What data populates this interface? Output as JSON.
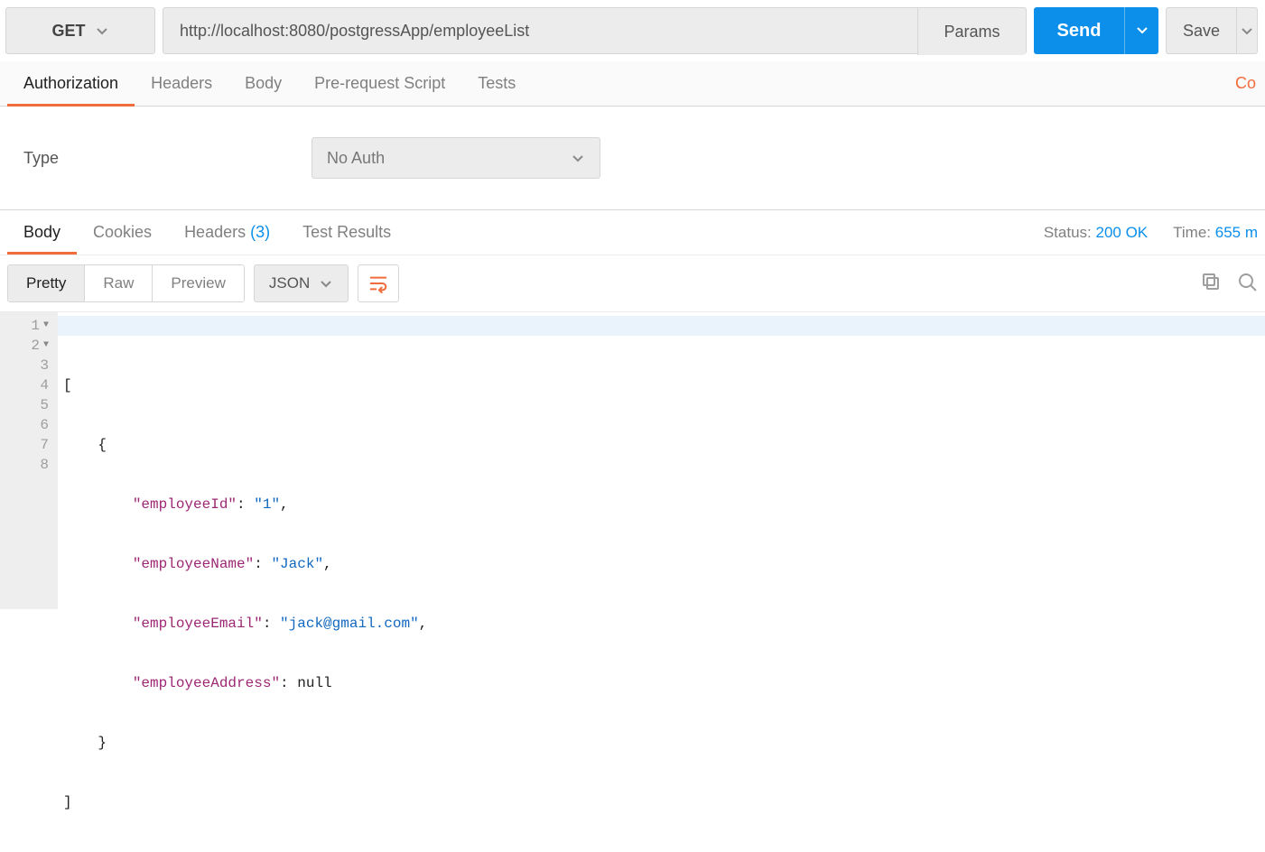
{
  "request": {
    "method": "GET",
    "url": "http://localhost:8080/postgressApp/employeeList",
    "params_btn": "Params",
    "send": "Send",
    "save": "Save"
  },
  "req_tabs": {
    "authorization": "Authorization",
    "headers": "Headers",
    "body": "Body",
    "pre_request": "Pre-request Script",
    "tests": "Tests",
    "right_link": "Co"
  },
  "auth": {
    "type_label": "Type",
    "value": "No Auth"
  },
  "resp_tabs": {
    "body": "Body",
    "cookies": "Cookies",
    "headers": "Headers",
    "headers_count": "(3)",
    "test_results": "Test Results"
  },
  "status": {
    "status_label": "Status:",
    "status_value": "200 OK",
    "time_label": "Time:",
    "time_value": "655 m"
  },
  "toolbar": {
    "pretty": "Pretty",
    "raw": "Raw",
    "preview": "Preview",
    "format": "JSON"
  },
  "code": {
    "lines": [
      "1",
      "2",
      "3",
      "4",
      "5",
      "6",
      "7",
      "8"
    ],
    "json": {
      "employeeId": "1",
      "employeeName": "Jack",
      "employeeEmail": "jack@gmail.com",
      "employeeAddress": null
    },
    "kv": {
      "k_id": "\"employeeId\"",
      "v_id": "\"1\"",
      "k_name": "\"employeeName\"",
      "v_name": "\"Jack\"",
      "k_email": "\"employeeEmail\"",
      "v_email": "\"jack@gmail.com\"",
      "k_addr": "\"employeeAddress\"",
      "v_addr": "null"
    }
  }
}
